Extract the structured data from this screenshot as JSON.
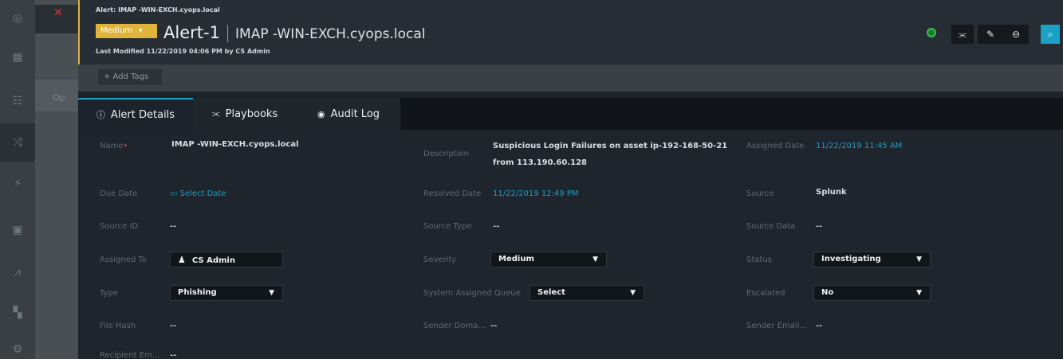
{
  "rail": {
    "icons": [
      "app-logo-icon",
      "dashboard-icon",
      "people-icon",
      "shuffle-icon",
      "bolt-icon",
      "briefcase-icon",
      "chart-icon",
      "grid-icon",
      "settings-icon"
    ]
  },
  "background": {
    "op_text": "Op"
  },
  "header": {
    "breadcrumb": "Alert: IMAP -WIN-EXCH.cyops.local",
    "severity_badge": "Medium",
    "title": "Alert-1",
    "subtitle": "IMAP -WIN-EXCH.cyops.local",
    "modified": "Last Modified 11/22/2019 04:06 PM by CS Admin",
    "add_tags": "+ Add Tags",
    "status_color": "#37c24f",
    "accent_color": "#e0b23c"
  },
  "tabs": [
    {
      "label": "Alert Details",
      "icon": "info-circle-icon"
    },
    {
      "label": "Playbooks",
      "icon": "playbook-icon"
    },
    {
      "label": "Audit Log",
      "icon": "eye-icon"
    }
  ],
  "fields": {
    "name_label": "Name",
    "name_value": "IMAP -WIN-EXCH.cyops.local",
    "description_label": "Description",
    "description_value": "Suspicious Login Failures on asset ip-192-168-50-21 from 113.190.60.128",
    "assigned_date_label": "Assigned Date",
    "assigned_date_value": "11/22/2019 11:45 AM",
    "due_date_label": "Due Date",
    "due_date_value": "Select Date",
    "resolved_date_label": "Resolved Date",
    "resolved_date_value": "11/22/2019 12:49 PM",
    "source_label": "Source",
    "source_value": "Splunk",
    "source_id_label": "Source ID",
    "source_id_value": "--",
    "source_type_label": "Source Type",
    "source_type_value": "--",
    "source_data_label": "Source Data",
    "source_data_value": "--",
    "assigned_to_label": "Assigned To",
    "assigned_to_value": "CS Admin",
    "severity_label": "Severity",
    "severity_value": "Medium",
    "status_label": "Status",
    "status_value": "Investigating",
    "type_label": "Type",
    "type_value": "Phishing",
    "queue_label": "System Assigned Queue",
    "queue_value": "Select",
    "escalated_label": "Escalated",
    "escalated_value": "No",
    "file_hash_label": "File Hash",
    "file_hash_value": "--",
    "sender_domain_label": "Sender Doma...",
    "sender_domain_value": "--",
    "sender_email_label": "Sender Email...",
    "sender_email_value": "--",
    "recipient_label": "Recipient Em...",
    "recipient_value": "--"
  },
  "link_color": "#1f9fc4"
}
